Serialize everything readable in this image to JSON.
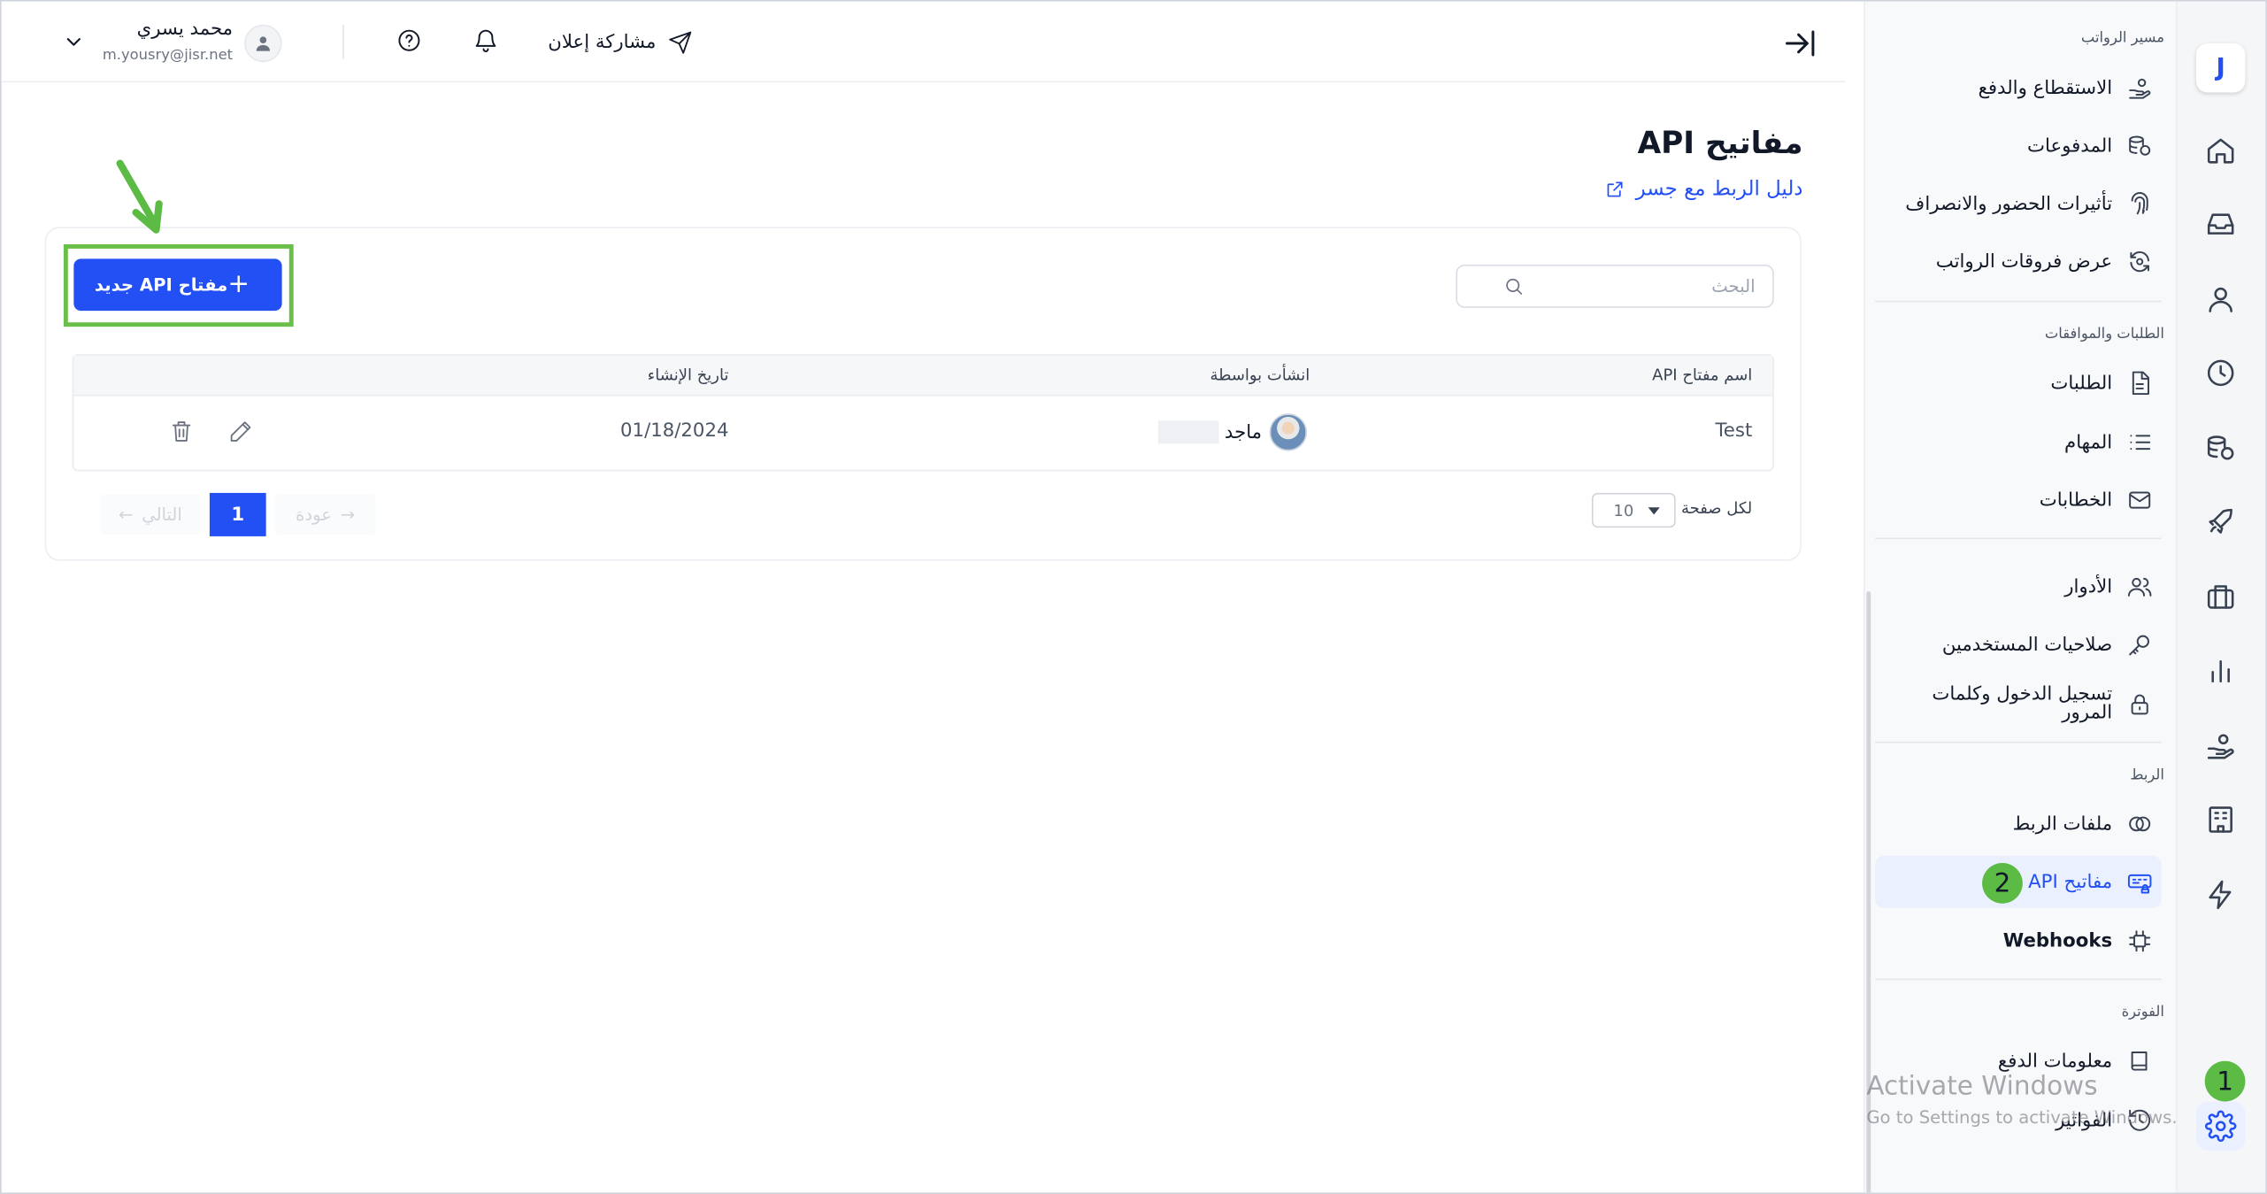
{
  "header": {
    "share_label": "مشاركة إعلان",
    "user_name": "محمد يسري",
    "user_email": "m.yousry@jisr.net"
  },
  "rail": {
    "logo_letter": "J"
  },
  "sidebar": {
    "sections": [
      {
        "title": "مسير الرواتب",
        "items": [
          {
            "label": "الاستقطاع والدفع",
            "icon": "hand-coins-icon"
          },
          {
            "label": "المدفوعات",
            "icon": "coins-stack-icon"
          },
          {
            "label": "تأثيرات الحضور والانصراف",
            "icon": "fingerprint-icon"
          },
          {
            "label": "عرض فروقات الرواتب",
            "icon": "refresh-money-icon"
          }
        ]
      },
      {
        "title": "الطلبات والموافقات",
        "items": [
          {
            "label": "الطلبات",
            "icon": "document-icon"
          },
          {
            "label": "المهام",
            "icon": "list-icon"
          },
          {
            "label": "الخطابات",
            "icon": "envelope-icon"
          }
        ]
      },
      {
        "title": "",
        "items": [
          {
            "label": "الأدوار",
            "icon": "users-icon"
          },
          {
            "label": "صلاحيات المستخدمين",
            "icon": "key-icon"
          },
          {
            "label": "تسجيل الدخول وكلمات المرور",
            "icon": "lock-icon"
          }
        ]
      },
      {
        "title": "الربط",
        "items": [
          {
            "label": "ملفات الربط",
            "icon": "link-circles-icon"
          },
          {
            "label": "مفاتيح API",
            "icon": "api-key-icon",
            "active": true
          },
          {
            "label": "Webhooks",
            "icon": "webhook-icon"
          }
        ]
      },
      {
        "title": "الفوترة",
        "items": [
          {
            "label": "معلومات الدفع",
            "icon": "book-icon"
          },
          {
            "label": "الفواتير",
            "icon": "history-icon"
          }
        ]
      }
    ]
  },
  "main": {
    "title": "مفاتيح API",
    "guide_link": "دليل الربط مع جسر",
    "new_key_button": "مفتاح API جديد",
    "search_placeholder": "البحث",
    "table": {
      "headers": [
        "اسم مفتاح API",
        "انشأت بواسطة",
        "تاريخ الإنشاء"
      ],
      "rows": [
        {
          "name": "Test",
          "created_by": "ماجد",
          "created_at": "01/18/2024"
        }
      ]
    },
    "pagination": {
      "per_page_label": "لكل صفحة",
      "per_page_value": "10",
      "back_label": "عودة",
      "current_page": "1",
      "next_label": "التالي"
    }
  },
  "annotations": {
    "badge_one": "1",
    "badge_two": "2",
    "arrow_color": "#5cbb45"
  },
  "watermark": {
    "title": "Activate Windows",
    "subtitle": "Go to Settings to activate Windows."
  },
  "colors": {
    "accent": "#2350f5",
    "highlight_green": "#6abf4b"
  }
}
